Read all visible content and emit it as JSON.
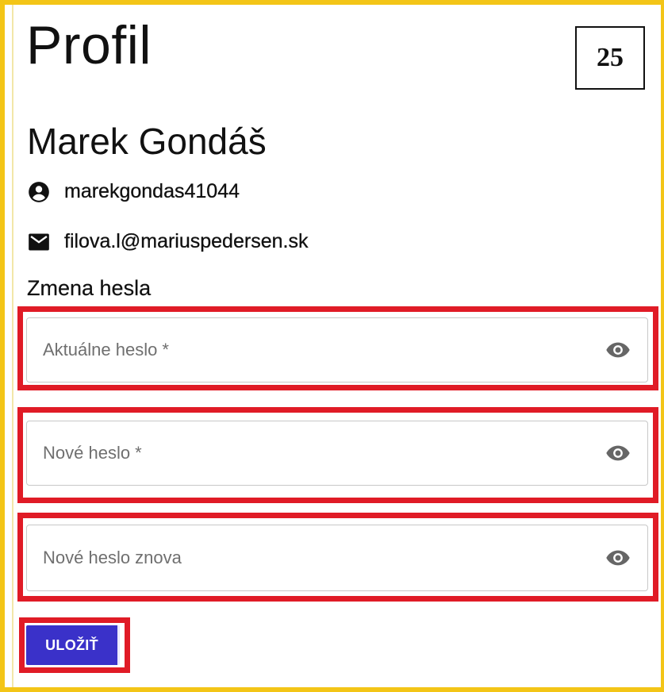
{
  "page": {
    "title": "Profil",
    "page_number": "25"
  },
  "profile": {
    "name": "Marek Gondáš",
    "username": "marekgondas41044",
    "email": "filova.l@mariuspedersen.sk",
    "username_icon": "account-circle-icon",
    "email_icon": "envelope-icon"
  },
  "password_section": {
    "title": "Zmena hesla",
    "fields": [
      {
        "placeholder": "Aktuálne heslo *",
        "icon": "eye-icon"
      },
      {
        "placeholder": "Nové heslo *",
        "icon": "eye-icon"
      },
      {
        "placeholder": "Nové heslo znova",
        "icon": "eye-icon"
      }
    ],
    "save_label": "ULOŽIŤ"
  },
  "colors": {
    "frame": "#f3c517",
    "highlight": "#e01b26",
    "button": "#3a31c9"
  }
}
